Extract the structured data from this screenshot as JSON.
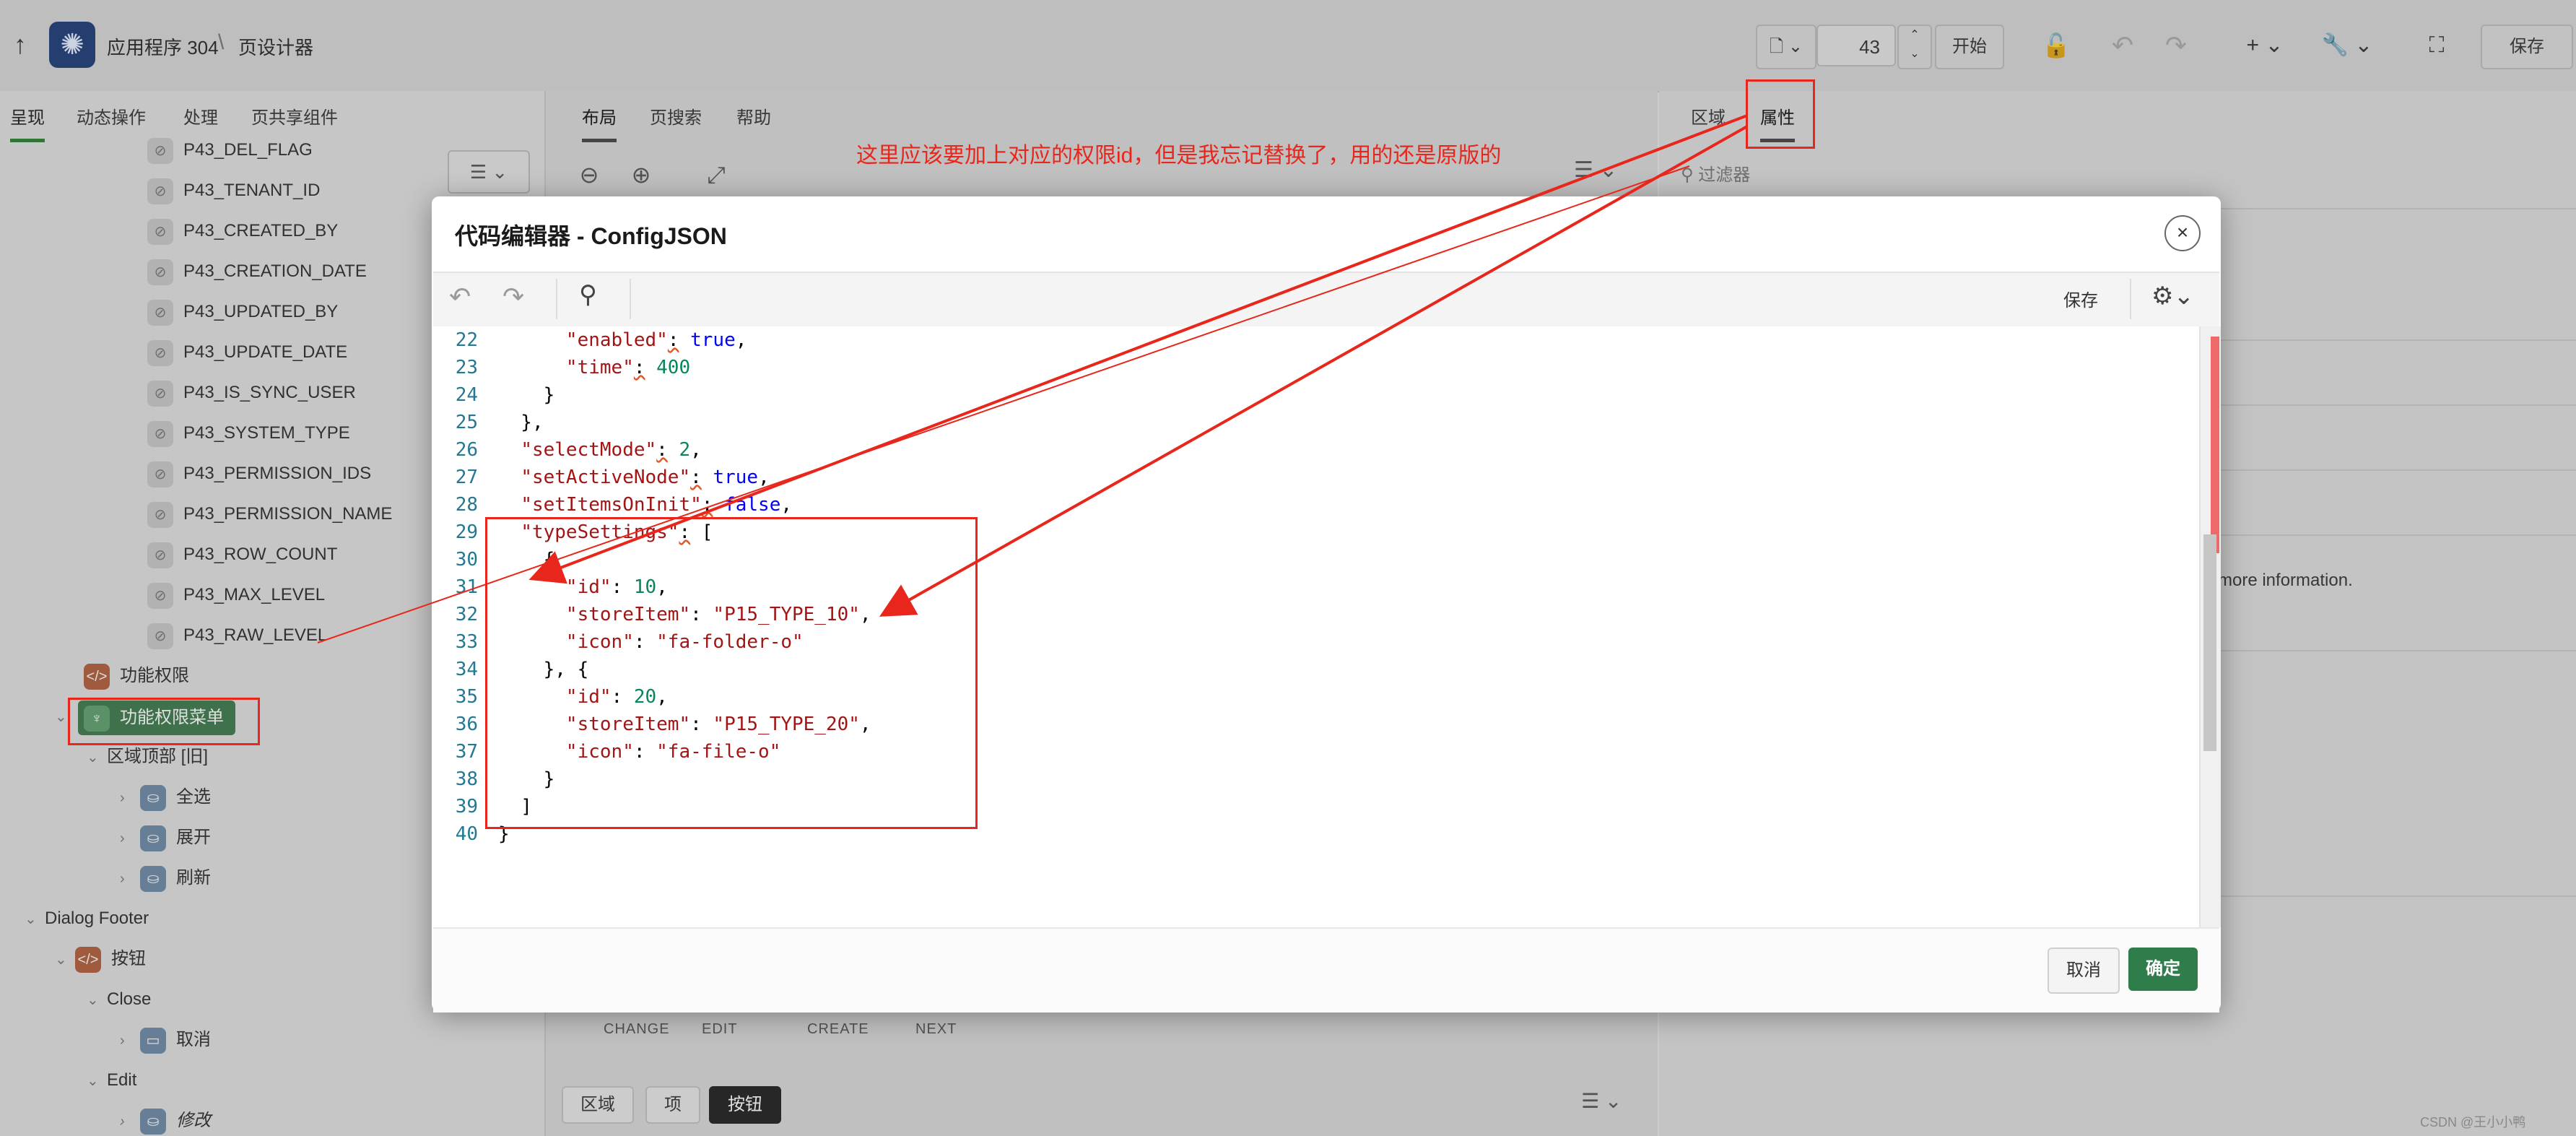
{
  "topbar": {
    "app_name": "应用程序 304",
    "separator": "\\",
    "page_name": "页设计器",
    "page_number": "43",
    "start_label": "开始",
    "save_label": "保存"
  },
  "left_panel": {
    "tabs": [
      "呈现",
      "动态操作",
      "处理",
      "页共享组件"
    ],
    "items": {
      "del_flag": "P43_DEL_FLAG",
      "tenant_id": "P43_TENANT_ID",
      "created_by": "P43_CREATED_BY",
      "creation_date": "P43_CREATION_DATE",
      "updated_by": "P43_UPDATED_BY",
      "update_date": "P43_UPDATE_DATE",
      "is_sync_user": "P43_IS_SYNC_USER",
      "system_type": "P43_SYSTEM_TYPE",
      "permission_ids": "P43_PERMISSION_IDS",
      "permission_name": "P43_PERMISSION_NAME",
      "row_count": "P43_ROW_COUNT",
      "max_level": "P43_MAX_LEVEL",
      "raw_level": "P43_RAW_LEVEL"
    },
    "func_perm": "功能权限",
    "func_perm_menu": "功能权限菜单",
    "region_top": "区域顶部 [旧]",
    "select_all": "全选",
    "expand": "展开",
    "refresh": "刷新",
    "dialog_footer": "Dialog Footer",
    "buttons": "按钮",
    "close": "Close",
    "cancel": "取消",
    "edit": "Edit",
    "modify": "修改"
  },
  "center_panel": {
    "tabs": [
      "布局",
      "页搜索",
      "帮助"
    ],
    "strip": [
      "CHANGE",
      "EDIT",
      "CREATE",
      "NEXT"
    ],
    "bottom_tabs": [
      "区域",
      "项",
      "按钮"
    ]
  },
  "right_panel": {
    "tabs": [
      "区域",
      "属性"
    ],
    "filter_placeholder": "过滤器",
    "info_text": "more information."
  },
  "modal": {
    "title": "代码编辑器 - ConfigJSON",
    "save_label": "保存",
    "cancel_label": "取消",
    "ok_label": "确定",
    "line_numbers": [
      "22",
      "23",
      "24",
      "25",
      "26",
      "27",
      "28",
      "29",
      "30",
      "31",
      "32",
      "33",
      "34",
      "35",
      "36",
      "37",
      "38",
      "39",
      "40"
    ],
    "code": {
      "l22_key": "\"enabled\"",
      "l22_val": "true",
      "l23_key": "\"time\"",
      "l23_val": "400",
      "l26_key": "\"selectMode\"",
      "l26_val": "2",
      "l27_key": "\"setActiveNode\"",
      "l27_val": "true",
      "l28_key": "\"setItemsOnInit\"",
      "l28_val": "false",
      "l29_key": "\"typeSettings\"",
      "id_key": "\"id\"",
      "id1_val": "10",
      "id2_val": "20",
      "store_key": "\"storeItem\"",
      "store1_val": "\"P15_TYPE_10\"",
      "store2_val": "\"P15_TYPE_20\"",
      "icon_key": "\"icon\"",
      "icon1_val": "\"fa-folder-o\"",
      "icon2_val": "\"fa-file-o\""
    }
  },
  "annotation": {
    "text": "这里应该要加上对应的权限id，但是我忘记替换了，用的还是原版的",
    "color": "#e8261b"
  },
  "watermark": "CSDN @王小小鸭"
}
